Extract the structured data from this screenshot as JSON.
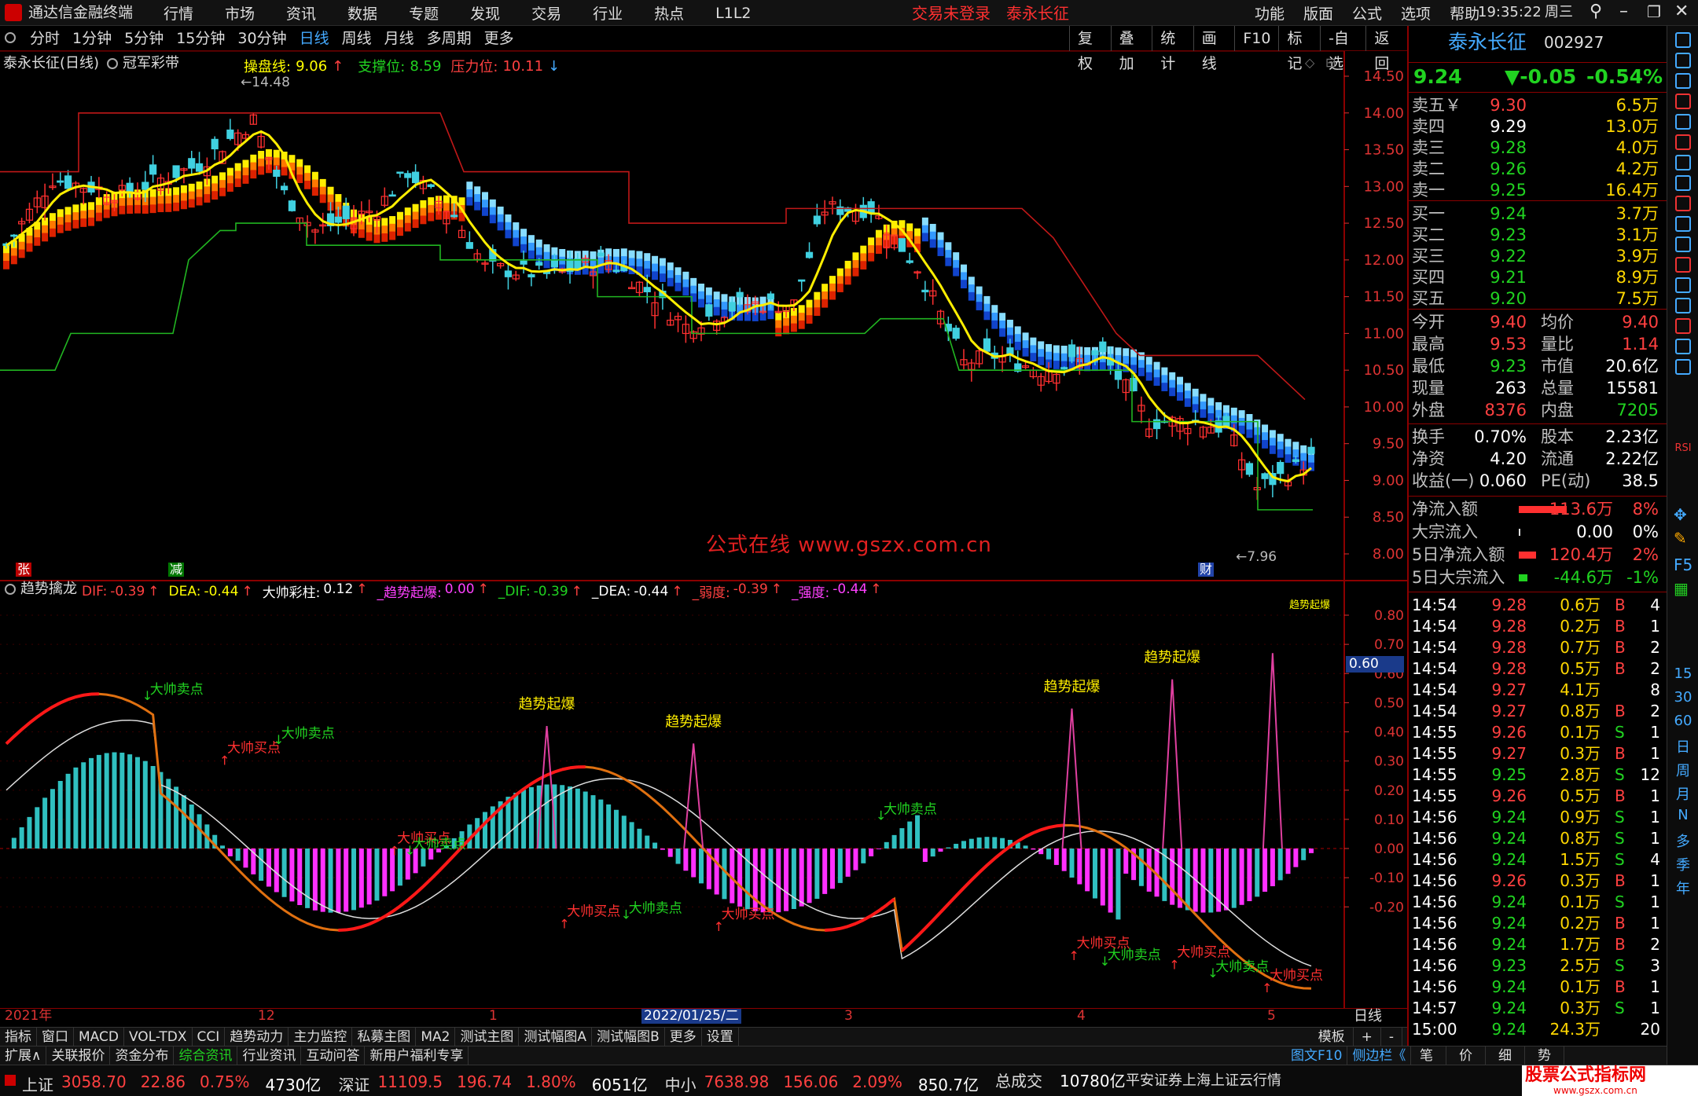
{
  "app": {
    "title": "通达信金融终端",
    "menu": [
      "行情",
      "市场",
      "资讯",
      "数据",
      "专题",
      "发现",
      "交易",
      "行业",
      "热点",
      "L1L2"
    ],
    "login_status": "交易未登录",
    "stock_tab": "泰永长征",
    "right_menu": [
      "功能",
      "版面",
      "公式",
      "选项",
      "帮助"
    ],
    "time": "19:35:22",
    "weekday": "周三"
  },
  "period_bar": {
    "periods": [
      "分时",
      "1分钟",
      "5分钟",
      "15分钟",
      "30分钟",
      "日线",
      "周线",
      "月线",
      "多周期",
      "更多"
    ],
    "selected": "日线",
    "tools": [
      "复权",
      "叠加",
      "统计",
      "画线",
      "F10",
      "标记",
      "-自选",
      "返回"
    ]
  },
  "main_chart": {
    "stock_label": "泰永长征(日线)",
    "indicator_label": "冠军彩带",
    "cpx_label": "操盘线:",
    "cpx_value": "9.06",
    "support_label": "支撑位:",
    "support_value": "8.59",
    "pressure_label": "压力位:",
    "pressure_value": "10.11",
    "high_mark": "14.48",
    "low_mark": "7.96",
    "watermark": "公式在线 www.gszx.com.cn",
    "y_ticks": [
      "14.50",
      "14.00",
      "13.50",
      "13.00",
      "12.50",
      "12.00",
      "11.50",
      "11.00",
      "10.50",
      "10.00",
      "9.50",
      "9.00",
      "8.50",
      "8.00"
    ],
    "markers": {
      "zhang": "张",
      "jian": "减",
      "cai": "财"
    }
  },
  "sub_chart": {
    "name": "趋势擒龙",
    "items": [
      {
        "label": "DIF:",
        "value": "-0.39",
        "arrow": "↑",
        "color": "#ff4040"
      },
      {
        "label": "DEA:",
        "value": "-0.44",
        "arrow": "↑",
        "color": "#ffff00"
      },
      {
        "label": "大帅彩柱:",
        "value": "0.12",
        "arrow": "↑",
        "color": "#ffffff"
      },
      {
        "label": "_趋势起爆:",
        "value": "0.00",
        "arrow": "↑",
        "color": "#ff40ff"
      },
      {
        "label": "_DIF:",
        "value": "-0.39",
        "arrow": "↑",
        "color": "#21d321"
      },
      {
        "label": "_DEA:",
        "value": "-0.44",
        "arrow": "↑",
        "color": "#ffffff"
      },
      {
        "label": "_弱度:",
        "value": "-0.39",
        "arrow": "↑",
        "color": "#ff4040"
      },
      {
        "label": "_强度:",
        "value": "-0.44",
        "arrow": "↑",
        "color": "#ff40ff"
      }
    ],
    "y_ticks": [
      "0.80",
      "0.70",
      "0.60",
      "0.50",
      "0.40",
      "0.30",
      "0.20",
      "0.10",
      "0.00",
      "-0.10",
      "-0.20"
    ],
    "current_value": "0.60",
    "signal_labels": {
      "burst": "趋势起爆",
      "sell": "大帅卖点",
      "buy": "大帅买点"
    }
  },
  "time_axis": {
    "labels": [
      "2021年",
      "12",
      "1",
      "2022/01/25/二",
      "3",
      "4",
      "5"
    ],
    "right_label": "日线"
  },
  "bottom_tabs": {
    "items": [
      "指标",
      "窗口",
      "MACD",
      "VOL-TDX",
      "CCI",
      "趋势动力",
      "主力监控",
      "私募主图",
      "MA2",
      "测试主图",
      "测试幅图A",
      "测试幅图B",
      "更多",
      "设置"
    ],
    "right": [
      "模板",
      "+",
      "-"
    ]
  },
  "info_tabs": {
    "items": [
      "扩展∧",
      "关联报价",
      "资金分布",
      "综合资讯",
      "行业资讯",
      "互动问答",
      "新用户福利专享"
    ],
    "right": [
      "图文F10",
      "侧边栏《"
    ]
  },
  "status_bar": {
    "indices": [
      {
        "name": "上证",
        "value": "3058.70",
        "chg": "22.86",
        "pct": "0.75%",
        "amt": "4730亿"
      },
      {
        "name": "深证",
        "value": "11109.5",
        "chg": "196.74",
        "pct": "1.80%",
        "amt": "6051亿"
      },
      {
        "name": "中小",
        "value": "7638.98",
        "chg": "156.06",
        "pct": "2.09%",
        "amt": "850.7亿"
      }
    ],
    "total_label": "总成交",
    "total_value": "10780亿",
    "broker": "平安证券上海上证云行情",
    "logo": "股票公式指标网",
    "logo_url": "www.gszx.com.cn"
  },
  "quote_panel": {
    "name": "泰永长征",
    "code": "002927",
    "price": "9.24",
    "change": "▼-0.05",
    "pct": "-0.54%",
    "asks": [
      {
        "label": "卖五￥",
        "price": "9.30",
        "vol": "6.5万"
      },
      {
        "label": "卖四",
        "price": "9.29",
        "vol": "13.0万"
      },
      {
        "label": "卖三",
        "price": "9.28",
        "vol": "4.0万"
      },
      {
        "label": "卖二",
        "price": "9.26",
        "vol": "4.2万"
      },
      {
        "label": "卖一",
        "price": "9.25",
        "vol": "16.4万"
      }
    ],
    "bids": [
      {
        "label": "买一",
        "price": "9.24",
        "vol": "3.7万"
      },
      {
        "label": "买二",
        "price": "9.23",
        "vol": "3.1万"
      },
      {
        "label": "买三",
        "price": "9.22",
        "vol": "3.9万"
      },
      {
        "label": "买四",
        "price": "9.21",
        "vol": "8.9万"
      },
      {
        "label": "买五",
        "price": "9.20",
        "vol": "7.5万"
      }
    ],
    "stats1": [
      {
        "l1": "今开",
        "v1": "9.40",
        "c1": "r",
        "l2": "均价",
        "v2": "9.40",
        "c2": "r"
      },
      {
        "l1": "最高",
        "v1": "9.53",
        "c1": "r",
        "l2": "量比",
        "v2": "1.14",
        "c2": "r"
      },
      {
        "l1": "最低",
        "v1": "9.23",
        "c1": "g",
        "l2": "市值",
        "v2": "20.6亿",
        "c2": "w"
      },
      {
        "l1": "现量",
        "v1": "263",
        "c1": "w",
        "l2": "总量",
        "v2": "15581",
        "c2": "w"
      },
      {
        "l1": "外盘",
        "v1": "8376",
        "c1": "r",
        "l2": "内盘",
        "v2": "7205",
        "c2": "g"
      }
    ],
    "stats2": [
      {
        "l1": "换手",
        "v1": "0.70%",
        "l2": "股本",
        "v2": "2.23亿"
      },
      {
        "l1": "净资",
        "v1": "4.20",
        "l2": "流通",
        "v2": "2.22亿"
      },
      {
        "l1": "收益(一)",
        "v1": "0.060",
        "l2": "PE(动)",
        "v2": "38.5"
      }
    ],
    "flows": [
      {
        "label": "净流入额",
        "value": "113.6万",
        "pct": "8%",
        "color": "r",
        "bar": 0.85
      },
      {
        "label": "大宗流入",
        "value": "0.00",
        "pct": "0%",
        "color": "w",
        "bar": 0.0
      },
      {
        "label": "5日净流入额",
        "value": "120.4万",
        "pct": "2%",
        "color": "r",
        "bar": 0.3
      },
      {
        "label": "5日大宗流入",
        "value": "-44.6万",
        "pct": "-1%",
        "color": "g",
        "bar": 0.15
      }
    ],
    "ticks": [
      {
        "t": "14:54",
        "p": "9.28",
        "v": "0.6万",
        "s": "B",
        "n": "4"
      },
      {
        "t": "14:54",
        "p": "9.28",
        "v": "0.2万",
        "s": "B",
        "n": "1"
      },
      {
        "t": "14:54",
        "p": "9.28",
        "v": "0.7万",
        "s": "B",
        "n": "2"
      },
      {
        "t": "14:54",
        "p": "9.28",
        "v": "0.5万",
        "s": "B",
        "n": "2"
      },
      {
        "t": "14:54",
        "p": "9.27",
        "v": "4.1万",
        "s": "",
        "n": "8"
      },
      {
        "t": "14:54",
        "p": "9.27",
        "v": "0.8万",
        "s": "B",
        "n": "2"
      },
      {
        "t": "14:55",
        "p": "9.26",
        "v": "0.1万",
        "s": "S",
        "n": "1"
      },
      {
        "t": "14:55",
        "p": "9.27",
        "v": "0.3万",
        "s": "B",
        "n": "1"
      },
      {
        "t": "14:55",
        "p": "9.25",
        "v": "2.8万",
        "s": "S",
        "n": "12"
      },
      {
        "t": "14:55",
        "p": "9.26",
        "v": "0.5万",
        "s": "B",
        "n": "1"
      },
      {
        "t": "14:56",
        "p": "9.24",
        "v": "0.9万",
        "s": "S",
        "n": "1"
      },
      {
        "t": "14:56",
        "p": "9.24",
        "v": "0.8万",
        "s": "S",
        "n": "1"
      },
      {
        "t": "14:56",
        "p": "9.24",
        "v": "1.5万",
        "s": "S",
        "n": "4"
      },
      {
        "t": "14:56",
        "p": "9.26",
        "v": "0.3万",
        "s": "B",
        "n": "1"
      },
      {
        "t": "14:56",
        "p": "9.24",
        "v": "0.1万",
        "s": "S",
        "n": "1"
      },
      {
        "t": "14:56",
        "p": "9.24",
        "v": "0.2万",
        "s": "B",
        "n": "1"
      },
      {
        "t": "14:56",
        "p": "9.24",
        "v": "1.7万",
        "s": "B",
        "n": "2"
      },
      {
        "t": "14:56",
        "p": "9.23",
        "v": "2.5万",
        "s": "S",
        "n": "3"
      },
      {
        "t": "14:56",
        "p": "9.24",
        "v": "0.1万",
        "s": "B",
        "n": "1"
      },
      {
        "t": "14:57",
        "p": "9.24",
        "v": "0.3万",
        "s": "S",
        "n": "1"
      },
      {
        "t": "15:00",
        "p": "9.24",
        "v": "24.3万",
        "s": "",
        "n": "20"
      }
    ],
    "bottom_tabs": [
      "笔",
      "价",
      "细",
      "势"
    ]
  },
  "side_toolbar": {
    "labels": [
      "RSI",
      "15",
      "30",
      "60",
      "日",
      "周",
      "月",
      "N",
      "多",
      "季",
      "年"
    ]
  }
}
